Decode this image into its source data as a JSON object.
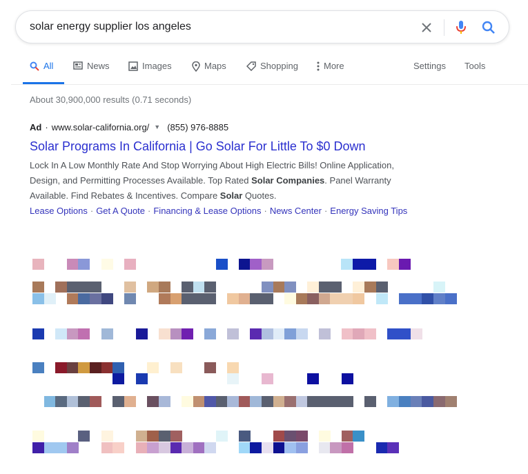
{
  "search": {
    "query": "solar energy supplier los angeles"
  },
  "tabs": [
    {
      "label": "All",
      "active": true
    },
    {
      "label": "News"
    },
    {
      "label": "Images"
    },
    {
      "label": "Maps"
    },
    {
      "label": "Shopping"
    },
    {
      "label": "More"
    }
  ],
  "tools": {
    "settings": "Settings",
    "tools": "Tools"
  },
  "result_stats": "About 30,900,000 results (0.71 seconds)",
  "ad": {
    "badge": "Ad",
    "url": "www.solar-california.org/",
    "phone": "(855) 976-8885",
    "title": "Solar Programs In California | Go Solar For Little To $0 Down",
    "desc1": "Lock In A Low Monthly Rate And Stop Worrying About High Electric Bills! Online Application,",
    "desc2_a": "Design, and Permitting Processes Available. Top Rated ",
    "desc2_b": "Solar Companies",
    "desc2_c": ". Panel Warranty",
    "desc3_a": "Available. Find Rebates & Incentives. Compare ",
    "desc3_b": "Solar",
    "desc3_c": " Quotes.",
    "sitelinks": [
      "Lease Options",
      "Get A Quote",
      "Financing & Lease Options",
      "News Center",
      "Energy Saving Tips"
    ]
  },
  "colors": {
    "accent": "#1a73e8",
    "link": "#1a0dab",
    "mic_blue": "#4285f4",
    "mic_red": "#ea4335"
  }
}
